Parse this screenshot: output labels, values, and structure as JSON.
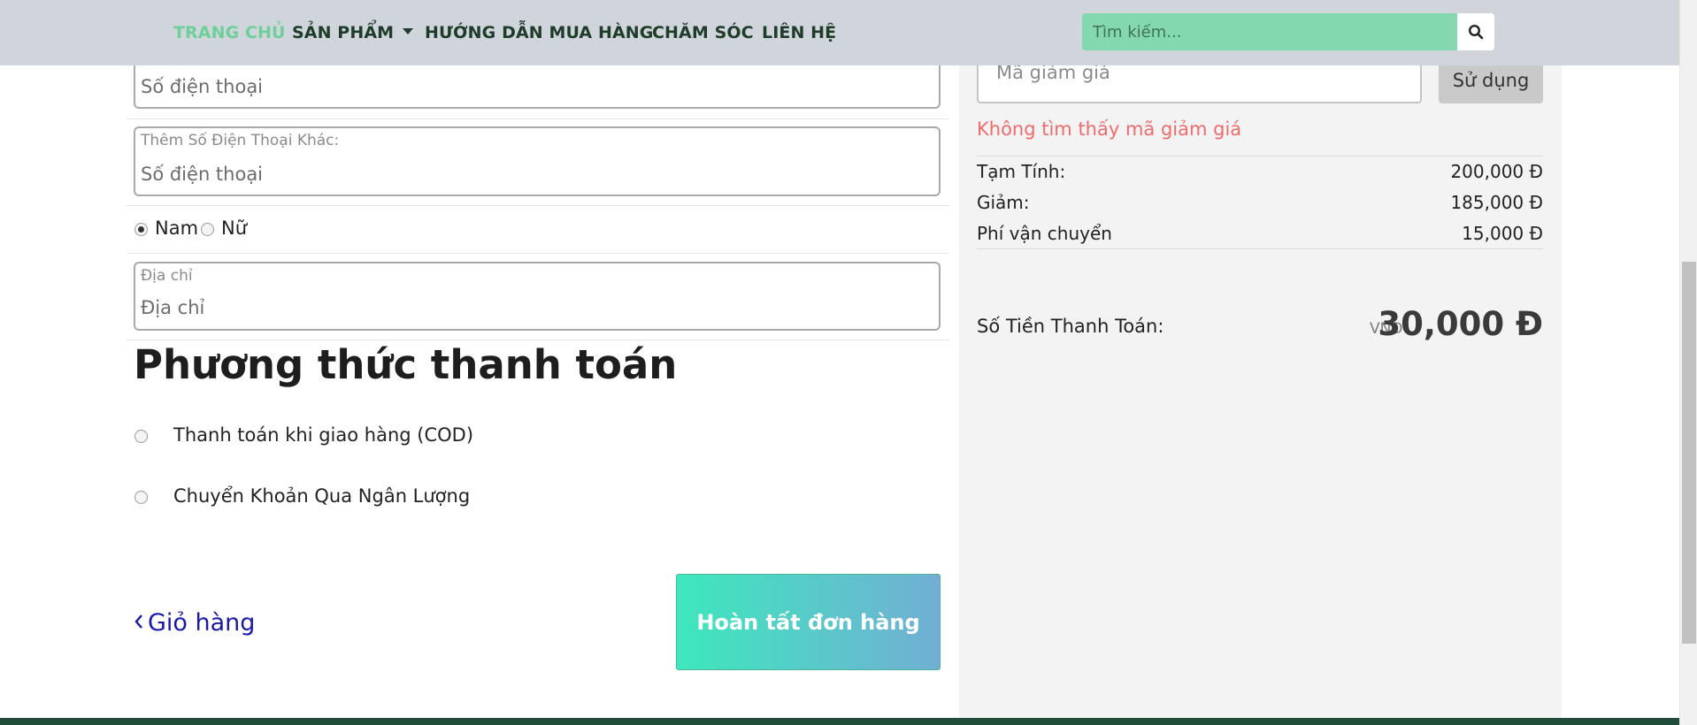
{
  "nav": {
    "items": [
      {
        "label": "TRANG CHỦ",
        "active": true
      },
      {
        "label": "SẢN PHẨM",
        "has_dropdown": true
      },
      {
        "label": "HƯỚNG DẪN MUA HÀNG"
      },
      {
        "label": "CHĂM SÓC"
      },
      {
        "label": "LIÊN HỆ"
      }
    ],
    "search_placeholder": "Tìm kiếm...",
    "search_icon": "search-icon"
  },
  "form": {
    "phone_input": "Số điện thoại",
    "other_phone_label": "Thêm Số Điện Thoại Khác:",
    "other_phone_input": "Số điện thoại",
    "gender": {
      "options": [
        "Nam",
        "Nữ"
      ],
      "selected": "Nam"
    },
    "address_label": "Địa chỉ",
    "address_input": "Địa chỉ"
  },
  "payment": {
    "title": "Phương thức thanh toán",
    "methods": [
      "Thanh toán khi giao hàng (COD)",
      "Chuyển Khoản Qua Ngân Lượng"
    ]
  },
  "actions": {
    "back_label": "Giỏ hàng",
    "complete_label": "Hoàn tất đơn hàng"
  },
  "summary": {
    "coupon_placeholder": "Mã giảm giá",
    "coupon_button": "Sử dụng",
    "coupon_error": "Không tìm thấy mã giảm giá",
    "rows": [
      {
        "label": "Tạm Tính:",
        "value": "200,000 Đ"
      },
      {
        "label": "Giảm:",
        "value": "185,000 Đ"
      },
      {
        "label": "Phí vận chuyển",
        "value": "15,000 Đ"
      }
    ],
    "total_label": "Số Tiền Thanh Toán:",
    "total_currency": "VND",
    "total_amount": "30,000 Đ"
  },
  "colors": {
    "navbar_bg": "#d0d5db",
    "nav_active": "#6fcf9b",
    "search_bg": "#84d8b0",
    "summary_bg": "#f3f3f3",
    "error": "#ef6b6b",
    "button_gradient_start": "#3de8bd",
    "button_gradient_end": "#72aed4",
    "footer": "#1f4d3a"
  }
}
